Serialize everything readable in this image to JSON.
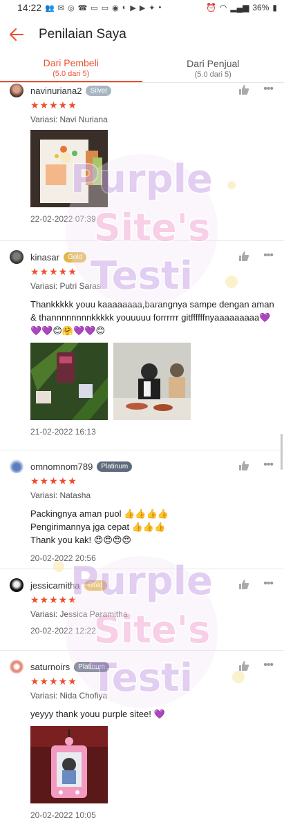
{
  "status_bar": {
    "time": "14:22",
    "left_icons": [
      "people-icon",
      "mail-icon",
      "whatsapp-icon",
      "phone-icon",
      "line-icon",
      "talk-icon",
      "messenger-icon",
      "chat-icon",
      "youtube-icon",
      "youtube-icon",
      "twitter-icon",
      "dot-icon"
    ],
    "battery": "36%"
  },
  "header": {
    "title": "Penilaian Saya",
    "accent": "#ee4d2d"
  },
  "tabs": [
    {
      "label": "Dari Pembeli",
      "sub": "(5.0 dari 5)",
      "active": true
    },
    {
      "label": "Dari Penjual",
      "sub": "(5.0 dari 5)",
      "active": false
    }
  ],
  "reviews": [
    {
      "username": "navinuriana2",
      "badge": "Silver",
      "stars": "★★★★★",
      "variant": "Variasi: Navi Nuriana",
      "comment": "",
      "date": "22-02-2022 07:39"
    },
    {
      "username": "kinasar",
      "badge": "Gold",
      "stars": "★★★★★",
      "variant": "Variasi: Putri Saras",
      "comment": "Thankkkkk youu kaaaaaaaa,barangnya sampe dengan aman & thannnnnnnnkkkkk youuuuu forrrrrr gitffffffnyaaaaaaaaa💜💜💜😊🤗💜💜😊",
      "date": "21-02-2022 16:13"
    },
    {
      "username": "omnomnom789",
      "badge": "Platinum",
      "stars": "★★★★★",
      "variant": "Variasi: Natasha",
      "comment": "Packingnya aman puol 👍👍👍👍\nPengirimannya jga cepat 👍👍👍\nThank you kak! 😍😍😍😍",
      "date": "20-02-2022 20:56"
    },
    {
      "username": "jessicamitha",
      "badge": "Gold",
      "stars": "★★★★★",
      "variant": "Variasi: Jessica Paramitha",
      "comment": "",
      "date": "20-02-2022 12:22"
    },
    {
      "username": "saturnoirs",
      "badge": "Platinum",
      "stars": "★★★★★",
      "variant": "Variasi: Nida Chofiya",
      "comment": "yeyyy thank youu purple sitee! 💜",
      "date": "20-02-2022 10:05"
    }
  ],
  "watermark": {
    "line1": "Purple",
    "line2": "Site's",
    "line3": "Testi",
    "color": "#c9a7e6"
  }
}
